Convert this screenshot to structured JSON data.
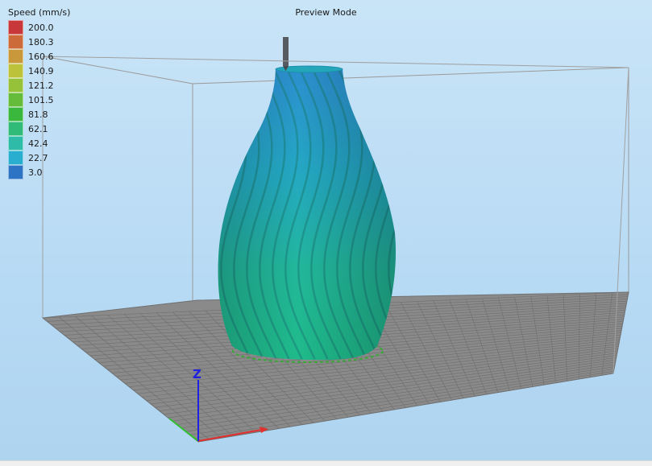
{
  "view": {
    "title": "Preview Mode"
  },
  "legend": {
    "title": "Speed (mm/s)",
    "items": [
      {
        "value": "200.0",
        "color": "#c8383a"
      },
      {
        "value": "180.3",
        "color": "#cc6a3a"
      },
      {
        "value": "160.6",
        "color": "#c8983a"
      },
      {
        "value": "140.9",
        "color": "#bcc23a"
      },
      {
        "value": "121.2",
        "color": "#96c23a"
      },
      {
        "value": "101.5",
        "color": "#64bc3a"
      },
      {
        "value": "81.8",
        "color": "#3ab83e"
      },
      {
        "value": "62.1",
        "color": "#30bc78"
      },
      {
        "value": "42.4",
        "color": "#2ebca8"
      },
      {
        "value": "22.7",
        "color": "#2aaed0"
      },
      {
        "value": "3.0",
        "color": "#2e74c4"
      }
    ]
  },
  "axes": {
    "x_color": "#e03030",
    "y_color": "#30c030",
    "z_color": "#2020e0",
    "z_label": "Z"
  },
  "colors": {
    "bed": "#8a8a8a",
    "grid": "#6a6a6a",
    "build_volume": "#9a9a9a"
  }
}
